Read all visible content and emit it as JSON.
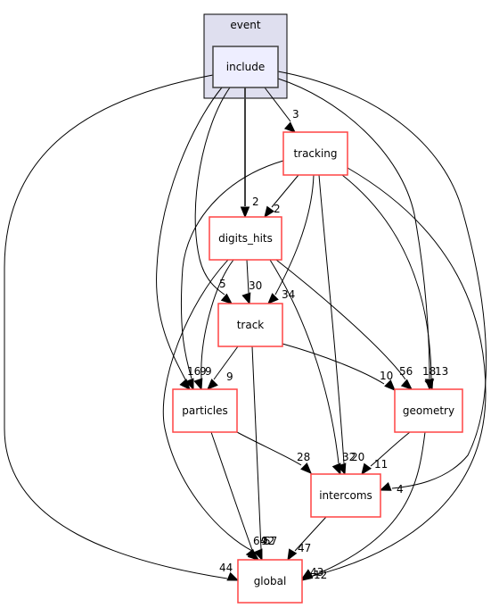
{
  "graph": {
    "cluster": {
      "id": "event",
      "label": "event",
      "fill": "#dfdfef",
      "stroke": "#000000"
    },
    "nodes": [
      {
        "id": "include",
        "label": "include",
        "fill": "#eeeeff",
        "stroke": "#404040",
        "in_cluster": true
      },
      {
        "id": "tracking",
        "label": "tracking",
        "fill": "#ffffff",
        "stroke": "#ff4444"
      },
      {
        "id": "digits_hits",
        "label": "digits_hits",
        "fill": "#ffffff",
        "stroke": "#ff4444"
      },
      {
        "id": "track",
        "label": "track",
        "fill": "#ffffff",
        "stroke": "#ff4444"
      },
      {
        "id": "particles",
        "label": "particles",
        "fill": "#ffffff",
        "stroke": "#ff4444"
      },
      {
        "id": "geometry",
        "label": "geometry",
        "fill": "#ffffff",
        "stroke": "#ff4444"
      },
      {
        "id": "intercoms",
        "label": "intercoms",
        "fill": "#ffffff",
        "stroke": "#ff4444"
      },
      {
        "id": "global",
        "label": "global",
        "fill": "#ffffff",
        "stroke": "#ff4444"
      }
    ],
    "edges": [
      {
        "from": "include",
        "to": "tracking",
        "label": "3"
      },
      {
        "from": "include",
        "to": "digits_hits",
        "label": "2"
      },
      {
        "from": "include",
        "to": "track",
        "label": "5"
      },
      {
        "from": "include",
        "to": "particles",
        "label": "16"
      },
      {
        "from": "include",
        "to": "geometry",
        "label": "13"
      },
      {
        "from": "include",
        "to": "intercoms",
        "label": "4"
      },
      {
        "from": "include",
        "to": "global",
        "label": "44"
      },
      {
        "from": "tracking",
        "to": "digits_hits",
        "label": "2"
      },
      {
        "from": "tracking",
        "to": "track",
        "label": "34"
      },
      {
        "from": "tracking",
        "to": "particles",
        "label": "9"
      },
      {
        "from": "tracking",
        "to": "geometry",
        "label": "18"
      },
      {
        "from": "tracking",
        "to": "intercoms",
        "label": "20"
      },
      {
        "from": "tracking",
        "to": "global",
        "label": "12"
      },
      {
        "from": "digits_hits",
        "to": "track",
        "label": "30"
      },
      {
        "from": "digits_hits",
        "to": "particles",
        "label": "9"
      },
      {
        "from": "digits_hits",
        "to": "geometry",
        "label": "56"
      },
      {
        "from": "digits_hits",
        "to": "intercoms",
        "label": "32"
      },
      {
        "from": "digits_hits",
        "to": "global",
        "label": "64"
      },
      {
        "from": "track",
        "to": "particles",
        "label": "9"
      },
      {
        "from": "track",
        "to": "geometry",
        "label": "10"
      },
      {
        "from": "track",
        "to": "global",
        "label": "57"
      },
      {
        "from": "particles",
        "to": "intercoms",
        "label": "28"
      },
      {
        "from": "particles",
        "to": "global",
        "label": "92"
      },
      {
        "from": "geometry",
        "to": "intercoms",
        "label": "11"
      },
      {
        "from": "geometry",
        "to": "global",
        "label": "43"
      },
      {
        "from": "intercoms",
        "to": "global",
        "label": "47"
      }
    ]
  }
}
